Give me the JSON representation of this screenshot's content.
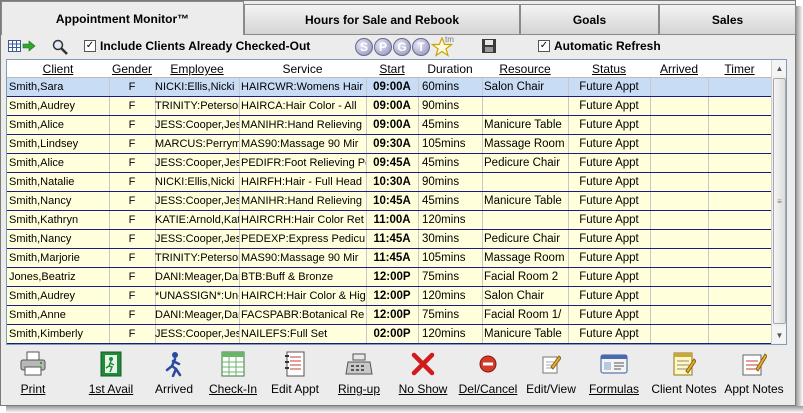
{
  "tabs": [
    {
      "label": "Appointment Monitor™",
      "active": true
    },
    {
      "label": "Hours for Sale and Rebook",
      "active": false
    },
    {
      "label": "Goals",
      "active": false
    },
    {
      "label": "Sales",
      "active": false
    }
  ],
  "toolbar": {
    "include_checked_out_label": "Include Clients Already Checked-Out",
    "include_checked_out": true,
    "spgt_letters": [
      "S",
      "P",
      "G",
      "T"
    ],
    "tm_mark": "tm",
    "auto_refresh_label": "Automatic Refresh",
    "auto_refresh": true
  },
  "grid": {
    "columns": [
      "Client",
      "Gender",
      "Employee",
      "Service",
      "Start",
      "Duration",
      "Resource",
      "Status",
      "Arrived",
      "Timer"
    ],
    "rows": [
      {
        "client": "Smith,Sara",
        "gender": "F",
        "employee": "NICKI:Ellis,Nicki",
        "service": "HAIRCWR:Womens Hair",
        "start": "09:00A",
        "duration": "60mins",
        "resource": "Salon Chair",
        "status": "Future Appt",
        "arrived": "",
        "timer": "",
        "selected": true
      },
      {
        "client": "Smith,Audrey",
        "gender": "F",
        "employee": "TRINITY:Peterson",
        "service": "HAIRCA:Hair Color - All",
        "start": "09:00A",
        "duration": "90mins",
        "resource": "",
        "status": "Future Appt",
        "arrived": "",
        "timer": "",
        "selected": false
      },
      {
        "client": "Smith,Alice",
        "gender": "F",
        "employee": "JESS:Cooper,Jes",
        "service": "MANIHR:Hand Relieving",
        "start": "09:00A",
        "duration": "45mins",
        "resource": "Manicure Table",
        "status": "Future Appt",
        "arrived": "",
        "timer": "",
        "selected": false
      },
      {
        "client": "Smith,Lindsey",
        "gender": "F",
        "employee": "MARCUS:Perryma",
        "service": "MAS90:Massage 90 Mir",
        "start": "09:30A",
        "duration": "105mins",
        "resource": "Massage Room",
        "status": "Future Appt",
        "arrived": "",
        "timer": "",
        "selected": false
      },
      {
        "client": "Smith,Alice",
        "gender": "F",
        "employee": "JESS:Cooper,Jes",
        "service": "PEDIFR:Foot Relieving Pe",
        "start": "09:45A",
        "duration": "45mins",
        "resource": "Pedicure Chair",
        "status": "Future Appt",
        "arrived": "",
        "timer": "",
        "selected": false
      },
      {
        "client": "Smith,Natalie",
        "gender": "F",
        "employee": "NICKI:Ellis,Nicki",
        "service": "HAIRFH:Hair - Full Head",
        "start": "10:30A",
        "duration": "90mins",
        "resource": "",
        "status": "Future Appt",
        "arrived": "",
        "timer": "",
        "selected": false
      },
      {
        "client": "Smith,Nancy",
        "gender": "F",
        "employee": "JESS:Cooper,Jes",
        "service": "MANIHR:Hand Relieving",
        "start": "10:45A",
        "duration": "45mins",
        "resource": "Manicure Table",
        "status": "Future Appt",
        "arrived": "",
        "timer": "",
        "selected": false
      },
      {
        "client": "Smith,Kathryn",
        "gender": "F",
        "employee": "KATIE:Arnold,Kat",
        "service": "HAIRCRH:Hair Color Ret",
        "start": "11:00A",
        "duration": "120mins",
        "resource": "",
        "status": "Future Appt",
        "arrived": "",
        "timer": "",
        "selected": false
      },
      {
        "client": "Smith,Nancy",
        "gender": "F",
        "employee": "JESS:Cooper,Jes",
        "service": "PEDEXP:Express Pedicu",
        "start": "11:45A",
        "duration": "30mins",
        "resource": "Pedicure Chair",
        "status": "Future Appt",
        "arrived": "",
        "timer": "",
        "selected": false
      },
      {
        "client": "Smith,Marjorie",
        "gender": "F",
        "employee": "TRINITY:Peterson",
        "service": "MAS90:Massage 90 Mir",
        "start": "11:45A",
        "duration": "105mins",
        "resource": "Massage Room",
        "status": "Future Appt",
        "arrived": "",
        "timer": "",
        "selected": false
      },
      {
        "client": "Jones,Beatriz",
        "gender": "F",
        "employee": "DANI:Meager,Dar",
        "service": "BTB:Buff & Bronze",
        "start": "12:00P",
        "duration": "75mins",
        "resource": "Facial Room 2",
        "status": "Future Appt",
        "arrived": "",
        "timer": "",
        "selected": false
      },
      {
        "client": "Smith,Audrey",
        "gender": "F",
        "employee": "*UNASSIGN*:Un-/",
        "service": "HAIRCH:Hair Color & Hig",
        "start": "12:00P",
        "duration": "120mins",
        "resource": "Salon Chair",
        "status": "Future Appt",
        "arrived": "",
        "timer": "",
        "selected": false
      },
      {
        "client": "Smith,Anne",
        "gender": "F",
        "employee": "DANI:Meager,Dar",
        "service": "FACSPABR:Botanical Re",
        "start": "12:00P",
        "duration": "75mins",
        "resource": "Facial Room 1/",
        "status": "Future Appt",
        "arrived": "",
        "timer": "",
        "selected": false
      },
      {
        "client": "Smith,Kimberly",
        "gender": "F",
        "employee": "JESS:Cooper,Jes",
        "service": "NAILEFS:Full Set",
        "start": "02:00P",
        "duration": "120mins",
        "resource": "Manicure Table",
        "status": "Future Appt",
        "arrived": "",
        "timer": "",
        "selected": false
      }
    ]
  },
  "buttons": [
    {
      "label": "Print",
      "icon": "printer-icon"
    },
    {
      "label": "1st Avail",
      "icon": "exit-door-icon"
    },
    {
      "label": "Arrived",
      "icon": "walking-person-icon"
    },
    {
      "label": "Check-In",
      "icon": "spreadsheet-icon"
    },
    {
      "label": "Edit Appt",
      "icon": "appointment-book-icon"
    },
    {
      "label": "Ring-up",
      "icon": "cash-register-icon"
    },
    {
      "label": "No Show",
      "icon": "red-x-icon"
    },
    {
      "label": "Del/Cancel",
      "icon": "no-entry-icon"
    },
    {
      "label": "Edit/View",
      "icon": "pencil-note-icon"
    },
    {
      "label": "Formulas",
      "icon": "id-card-icon"
    },
    {
      "label": "Client Notes",
      "icon": "notepad-icon"
    },
    {
      "label": "Appt Notes",
      "icon": "appt-notes-icon"
    }
  ],
  "colors": {
    "row_bg": "#ffffdb",
    "row_selected_bg": "#c9dcf5",
    "row_border": "#1a1a8a",
    "window_bg": "#ececec"
  }
}
